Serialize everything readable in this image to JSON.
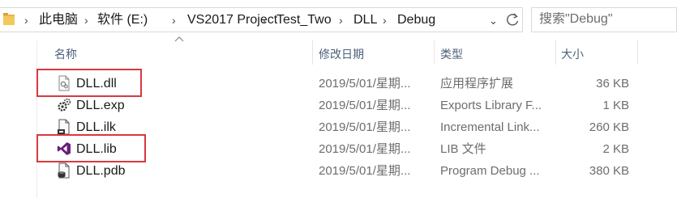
{
  "breadcrumb": {
    "items": [
      "此电脑",
      "软件 (E:)",
      "VS2017 Project",
      "Test_Two",
      "DLL",
      "Debug"
    ]
  },
  "search": {
    "placeholder": "搜索\"Debug\""
  },
  "columns": {
    "name": "名称",
    "date": "修改日期",
    "type": "类型",
    "size": "大小"
  },
  "files": [
    {
      "name": "DLL.dll",
      "date": "2019/5/01/星期...",
      "type": "应用程序扩展",
      "size": "36 KB",
      "icon": "dll-file-icon",
      "highlighted": true
    },
    {
      "name": "DLL.exp",
      "date": "2019/5/01/星期...",
      "type": "Exports Library F...",
      "size": "1 KB",
      "icon": "exp-file-icon",
      "highlighted": false
    },
    {
      "name": "DLL.ilk",
      "date": "2019/5/01/星期...",
      "type": "Incremental Link...",
      "size": "260 KB",
      "icon": "ilk-file-icon",
      "highlighted": false
    },
    {
      "name": "DLL.lib",
      "date": "2019/5/01/星期...",
      "type": "LIB 文件",
      "size": "2 KB",
      "icon": "visual-studio-icon",
      "highlighted": true
    },
    {
      "name": "DLL.pdb",
      "date": "2019/5/01/星期...",
      "type": "Program Debug ...",
      "size": "380 KB",
      "icon": "pdb-file-icon",
      "highlighted": false
    }
  ],
  "colors": {
    "highlight": "#d9383f",
    "header_text": "#4c607a",
    "vs_purple": "#68217a"
  }
}
